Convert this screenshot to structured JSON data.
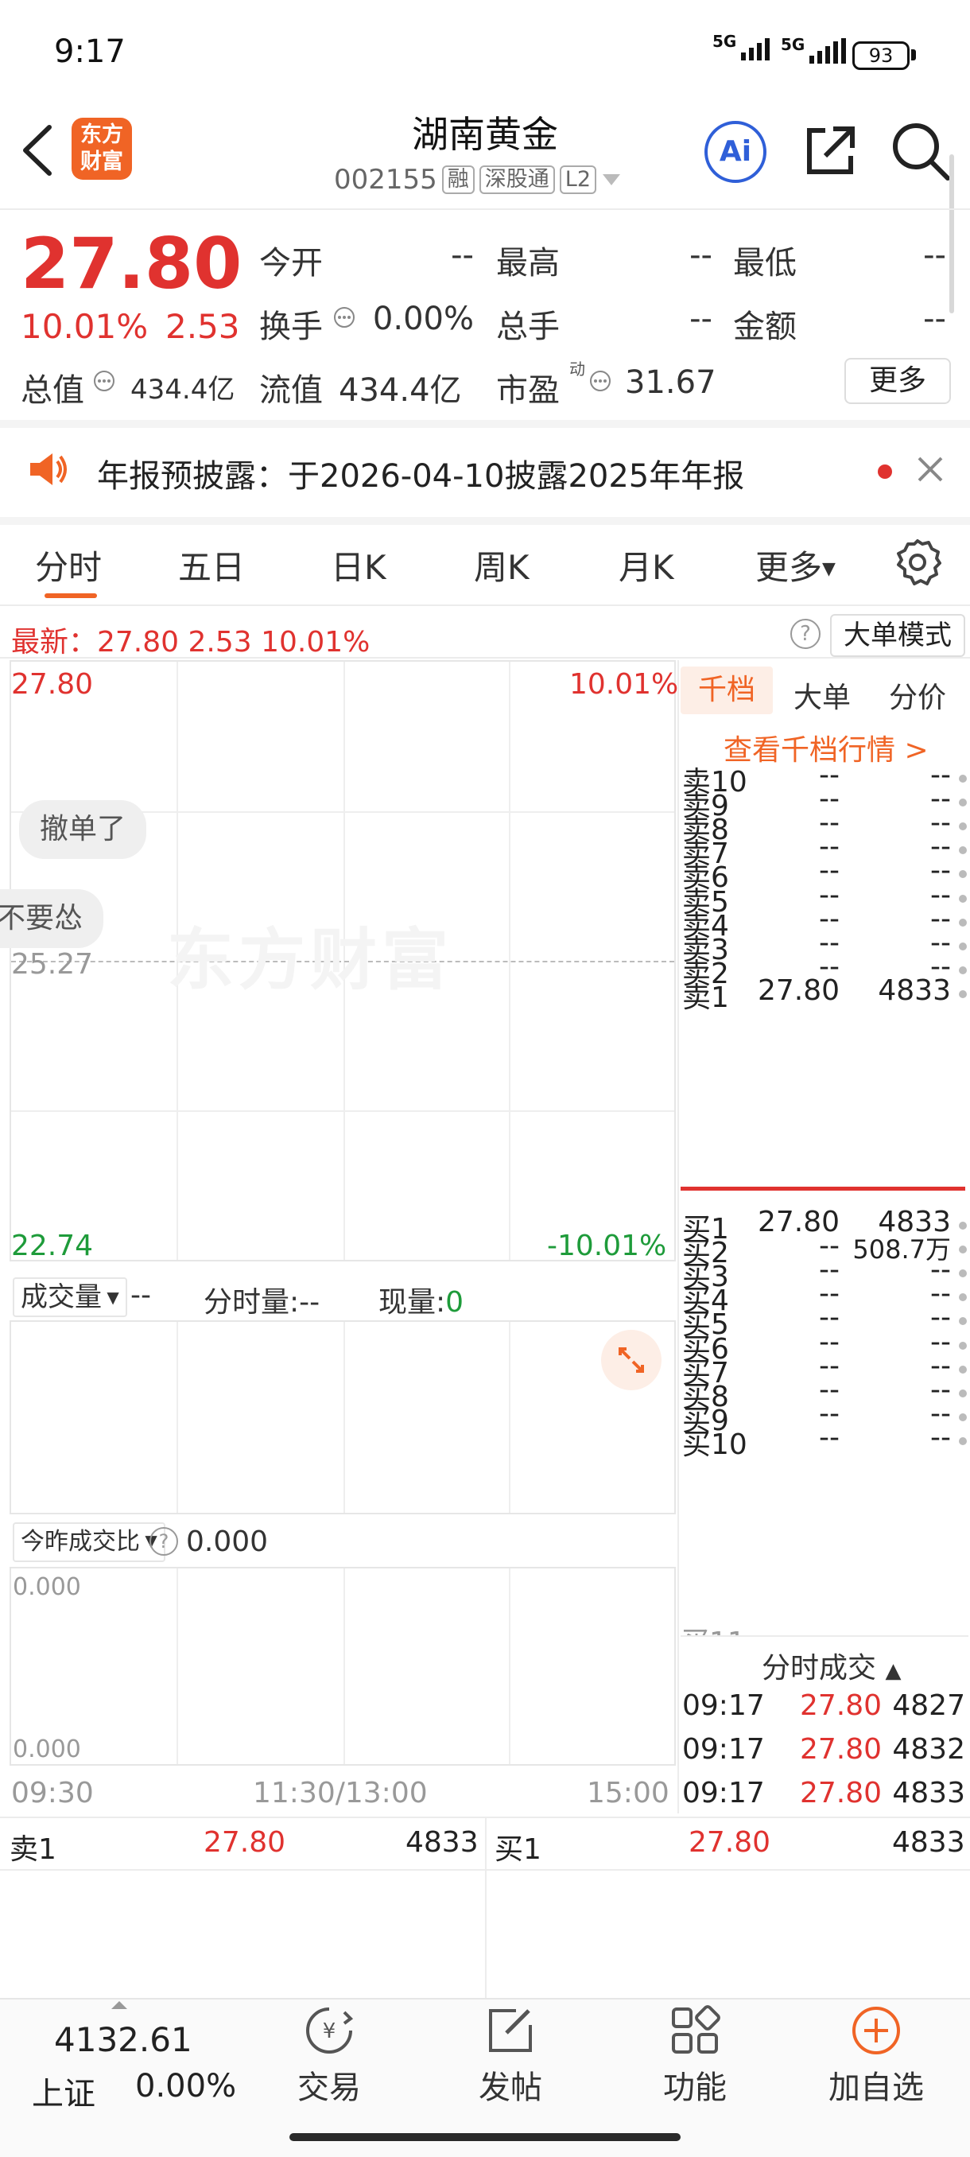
{
  "status_bar": {
    "time": "9:17",
    "signal1": "5G",
    "signal2": "5G",
    "battery": "93"
  },
  "header": {
    "logo": "东方财富",
    "title": "湖南黄金",
    "code": "002155",
    "tags": [
      "融",
      "深股通",
      "L2"
    ]
  },
  "quote": {
    "price": "27.80",
    "change_pct": "10.01%",
    "change": "2.53",
    "open_label": "今开",
    "open_val": "--",
    "high_label": "最高",
    "high_val": "--",
    "low_label": "最低",
    "low_val": "--",
    "turnover_label": "换手",
    "turnover_val": "0.00%",
    "volume_label": "总手",
    "volume_val": "--",
    "amount_label": "金额",
    "amount_val": "--",
    "mktcap_label": "总值",
    "mktcap_val": "434.4亿",
    "float_label": "流值",
    "float_val": "434.4亿",
    "pe_label": "市盈",
    "pe_sup": "动",
    "pe_val": "31.67",
    "more": "更多"
  },
  "notice": {
    "text": "年报预披露：于2026-04-10披露2025年年报"
  },
  "tabs": [
    "分时",
    "五日",
    "日K",
    "周K",
    "月K",
    "更多"
  ],
  "latest": {
    "text": "最新：27.80  2.53  10.01%",
    "mode": "大单模式"
  },
  "chart": {
    "top_price": "27.80",
    "top_pct": "10.01%",
    "mid_price": "25.27",
    "bottom_price": "22.74",
    "bottom_pct": "-10.01%",
    "watermark": "东方财富",
    "bubble1": "撤单了",
    "bubble2": "不要怂",
    "vol_selector": "成交量",
    "vol_val": "--",
    "vol_min_label": "分时量:",
    "vol_min_val": "--",
    "vol_now_label": "现量:",
    "vol_now_val": "0",
    "ratio_selector": "今昨成交比",
    "ratio_val": "0.000",
    "ratio_top": "0.000",
    "ratio_bottom": "0.000",
    "time_start": "09:30",
    "time_mid": "11:30/13:00",
    "time_end": "15:00"
  },
  "orderbook": {
    "tabs": [
      "千档",
      "大单",
      "分价"
    ],
    "link": "查看千档行情 >",
    "sells": [
      {
        "name": "卖10",
        "price": "--",
        "vol": "--"
      },
      {
        "name": "卖9",
        "price": "--",
        "vol": "--"
      },
      {
        "name": "卖8",
        "price": "--",
        "vol": "--"
      },
      {
        "name": "卖7",
        "price": "--",
        "vol": "--"
      },
      {
        "name": "卖6",
        "price": "--",
        "vol": "--"
      },
      {
        "name": "卖5",
        "price": "--",
        "vol": "--"
      },
      {
        "name": "卖4",
        "price": "--",
        "vol": "--"
      },
      {
        "name": "卖3",
        "price": "--",
        "vol": "--"
      },
      {
        "name": "卖2",
        "price": "--",
        "vol": "--"
      },
      {
        "name": "卖1",
        "price": "27.80",
        "vol": "4833"
      }
    ],
    "buys": [
      {
        "name": "买1",
        "price": "27.80",
        "vol": "4833"
      },
      {
        "name": "买2",
        "price": "--",
        "vol": "508.7万"
      },
      {
        "name": "买3",
        "price": "--",
        "vol": "--"
      },
      {
        "name": "买4",
        "price": "--",
        "vol": "--"
      },
      {
        "name": "买5",
        "price": "--",
        "vol": "--"
      },
      {
        "name": "买6",
        "price": "--",
        "vol": "--"
      },
      {
        "name": "买7",
        "price": "--",
        "vol": "--"
      },
      {
        "name": "买8",
        "price": "--",
        "vol": "--"
      },
      {
        "name": "买9",
        "price": "--",
        "vol": "--"
      },
      {
        "name": "买10",
        "price": "--",
        "vol": "--"
      }
    ],
    "ticks_title": "分时成交",
    "ticks": [
      {
        "time": "09:17",
        "price": "27.80",
        "vol": "4827"
      },
      {
        "time": "09:17",
        "price": "27.80",
        "vol": "4832"
      },
      {
        "time": "09:17",
        "price": "27.80",
        "vol": "4833"
      }
    ]
  },
  "bottom_quote": {
    "sell_label": "卖1",
    "sell_price": "27.80",
    "sell_vol": "4833",
    "buy_label": "买1",
    "buy_price": "27.80",
    "buy_vol": "4833"
  },
  "bottom_nav": {
    "index_value": "4132.61",
    "index_name": "上证",
    "index_pct": "0.00%",
    "items": [
      "交易",
      "发帖",
      "功能",
      "加自选"
    ]
  }
}
